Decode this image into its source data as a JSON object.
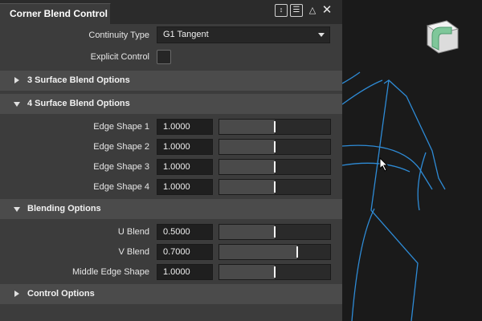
{
  "panel": {
    "title": "Corner Blend Control",
    "buttons": [
      "pin-icon",
      "menu-icon",
      "collapse-icon",
      "close-icon"
    ]
  },
  "continuity": {
    "label": "Continuity Type",
    "value": "G1 Tangent"
  },
  "explicit_control": {
    "label": "Explicit Control",
    "checked": false
  },
  "sections": {
    "three_surface": {
      "label": "3 Surface Blend Options",
      "expanded": false
    },
    "four_surface": {
      "label": "4 Surface Blend Options",
      "expanded": true
    },
    "blending": {
      "label": "Blending Options",
      "expanded": true
    },
    "control": {
      "label": "Control Options",
      "expanded": false
    }
  },
  "edge_shapes": [
    {
      "label": "Edge Shape 1",
      "value": "1.0000",
      "level": 0.5
    },
    {
      "label": "Edge Shape 2",
      "value": "1.0000",
      "level": 0.5
    },
    {
      "label": "Edge Shape 3",
      "value": "1.0000",
      "level": 0.5
    },
    {
      "label": "Edge Shape 4",
      "value": "1.0000",
      "level": 0.5
    }
  ],
  "blending_fields": [
    {
      "label": "U Blend",
      "value": "0.5000",
      "level": 0.5
    },
    {
      "label": "V Blend",
      "value": "0.7000",
      "level": 0.7
    },
    {
      "label": "Middle Edge Shape",
      "value": "1.0000",
      "level": 0.5
    }
  ],
  "colors": {
    "panel_bg": "#3c3c3c",
    "section_bg": "#4b4b4b",
    "curve": "#2e8bd6",
    "viewport_bg": "#1a1a1a"
  },
  "viewport": {
    "nav_cube_icon": "corner-blend-cube-icon",
    "cursor_icon": "arrow-cursor-icon"
  }
}
